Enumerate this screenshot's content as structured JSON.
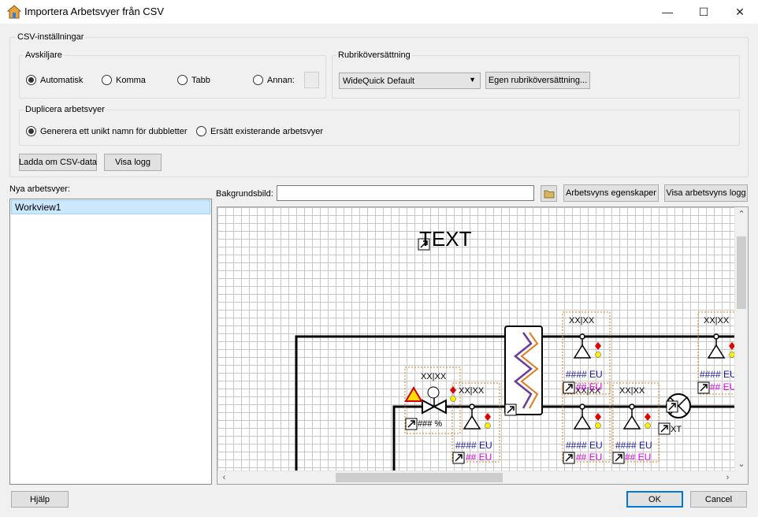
{
  "window": {
    "title": "Importera Arbetsvyer från CSV",
    "minimize": "—",
    "maximize": "☐",
    "close": "✕"
  },
  "csv_settings": {
    "title": "CSV-inställningar",
    "separator": {
      "title": "Avskiljare",
      "options": [
        "Automatisk",
        "Komma",
        "Tabb",
        "Annan:"
      ],
      "selected": "Automatisk"
    },
    "header_translation": {
      "title": "Rubriköversättning",
      "selected": "WideQuick Default",
      "custom_button": "Egen rubriköversättning..."
    },
    "duplicates": {
      "title": "Duplicera arbetsvyer",
      "options": [
        "Generera ett unikt namn för dubbletter",
        "Ersätt existerande arbetsvyer"
      ],
      "selected": "Generera ett unikt namn för dubbletter"
    },
    "reload_button": "Ladda om CSV-data",
    "log_button": "Visa logg"
  },
  "new_workviews": {
    "label": "Nya arbetsvyer:",
    "items": [
      "Workview1"
    ]
  },
  "background": {
    "label": "Bakgrundsbild:",
    "value": "",
    "props_button": "Arbetsvyns egenskaper",
    "log_button": "Visa arbetsvyns logg"
  },
  "canvas": {
    "text_object": "TEXT",
    "tags": [
      "XX|XX",
      "XX|XX",
      "XX|XX",
      "XX|XX",
      "XX|XX",
      "XX|XX"
    ],
    "unit_blue": "#### EU",
    "unit_magenta": "## EU",
    "percent": "### %",
    "xt": "XT"
  },
  "footer": {
    "help": "Hjälp",
    "ok": "OK",
    "cancel": "Cancel"
  },
  "colors": {
    "accent": "#0078d7",
    "pipe": "#000000",
    "orange": "#e07b1a",
    "purple": "#6a3d9a",
    "blue_text": "#1a1aa6",
    "magenta_text": "#e000e0",
    "red": "#e00000",
    "yellow": "#ffee00"
  }
}
